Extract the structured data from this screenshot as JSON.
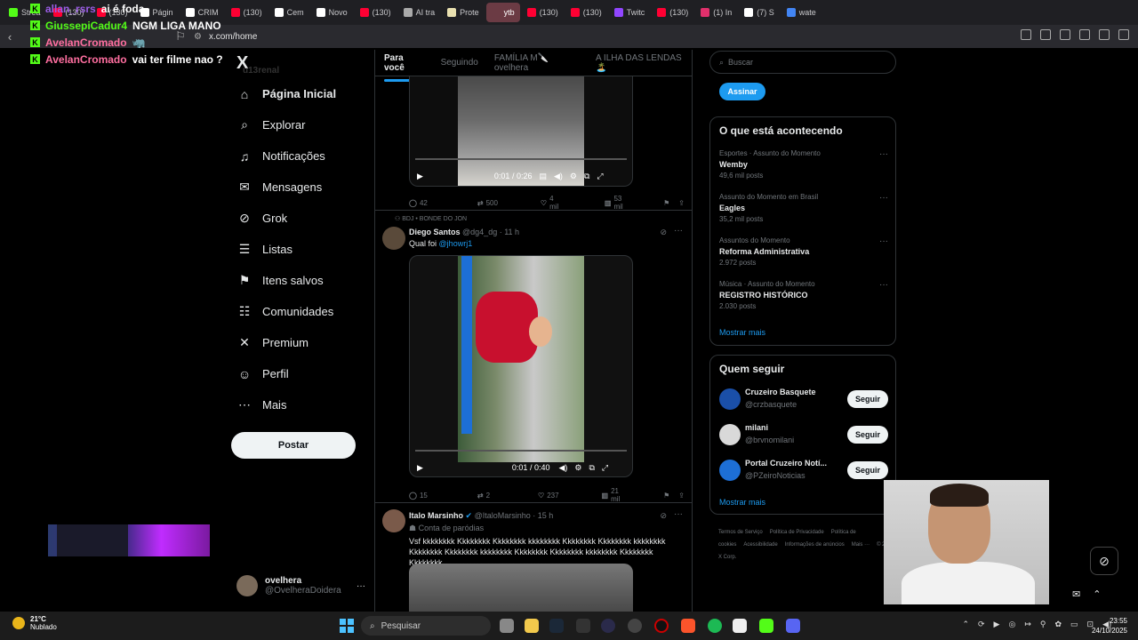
{
  "browser": {
    "tabs": [
      {
        "label": "Strea",
        "color": "#53fc18"
      },
      {
        "label": "(130)",
        "color": "#ff0033"
      },
      {
        "label": "(130)",
        "color": "#ff0033"
      },
      {
        "label": "Págin",
        "color": "#ffffff"
      },
      {
        "label": "CRIM",
        "color": "#ffffff"
      },
      {
        "label": "(130)",
        "color": "#ff0033"
      },
      {
        "label": "Cem",
        "color": "#ffffff"
      },
      {
        "label": "Novo",
        "color": "#ffffff"
      },
      {
        "label": "(130)",
        "color": "#ff0033"
      },
      {
        "label": "AI tra",
        "color": "#aaaaaa"
      },
      {
        "label": "Prote",
        "color": "#e9e0b0"
      },
      {
        "label": "ytb",
        "color": "#6b3b44"
      },
      {
        "label": "(130)",
        "color": "#ff0033"
      },
      {
        "label": "(130)",
        "color": "#ff0033"
      },
      {
        "label": "Twitc",
        "color": "#9146ff"
      },
      {
        "label": "(130)",
        "color": "#ff0033"
      },
      {
        "label": "(1) In",
        "color": "#e1306c"
      },
      {
        "label": "(7) S",
        "color": "#ffffff"
      },
      {
        "label": "wate",
        "color": "#4285f4"
      }
    ],
    "active_tab_index": 11,
    "url": "x.com/home"
  },
  "chat": [
    {
      "user": "allan_rsrs",
      "message": "ai é foda",
      "user_color": "#9b5de5"
    },
    {
      "user": "GiussepiCadur4",
      "message": "NGM LIGA MANO",
      "user_color": "#53fc18"
    },
    {
      "user": "AvelanCromado",
      "message": "🦏",
      "user_color": "#ff6fa0"
    },
    {
      "user": "AvelanCromado",
      "message": "vai ter filme nao ?",
      "user_color": "#ff6fa0"
    }
  ],
  "nav": {
    "logo": "X",
    "ghost_text": "u13renal",
    "items": [
      {
        "label": "Página Inicial",
        "icon": "home-icon",
        "glyph": "⌂"
      },
      {
        "label": "Explorar",
        "icon": "search-icon",
        "glyph": "⌕"
      },
      {
        "label": "Notificações",
        "icon": "bell-icon",
        "glyph": "♫"
      },
      {
        "label": "Mensagens",
        "icon": "mail-icon",
        "glyph": "✉"
      },
      {
        "label": "Grok",
        "icon": "grok-icon",
        "glyph": "⊘"
      },
      {
        "label": "Listas",
        "icon": "list-icon",
        "glyph": "☰"
      },
      {
        "label": "Itens salvos",
        "icon": "bookmark-icon",
        "glyph": "⚑"
      },
      {
        "label": "Comunidades",
        "icon": "communities-icon",
        "glyph": "☷"
      },
      {
        "label": "Premium",
        "icon": "premium-x-icon",
        "glyph": "✕"
      },
      {
        "label": "Perfil",
        "icon": "profile-icon",
        "glyph": "☺"
      },
      {
        "label": "Mais",
        "icon": "more-icon",
        "glyph": "⋯"
      }
    ],
    "post_label": "Postar",
    "account": {
      "name": "ovelhera",
      "handle": "@OvelheraDoidera"
    }
  },
  "feed": {
    "tabs": [
      "Para você",
      "Seguindo",
      "FAMÍLIA M🔪ovelhera",
      "A ILHA DAS LENDAS 🏝️"
    ],
    "video1": {
      "time": "0:01 / 0:26"
    },
    "stats1": {
      "replies": "42",
      "reposts": "500",
      "likes": "4 mil",
      "views": "53 mil"
    },
    "tweet2": {
      "context": "BDJ • BONDE DO JON",
      "name": "Diego Santos",
      "handle": "@dg4_dg",
      "time": "· 11 h",
      "text": "Qual foi",
      "mention": "@jhowrj1",
      "video_time": "0:01 / 0:40"
    },
    "stats2": {
      "replies": "15",
      "reposts": "2",
      "likes": "237",
      "views": "21 mil"
    },
    "tweet3": {
      "name": "Italo Marsinho",
      "handle": "@ItaloMarsinho",
      "time": "· 15 h",
      "label": "Conta de paródias",
      "text": "Vsf kkkkkkkk Kkkkkkkk Kkkkkkkk kkkkkkkk Kkkkkkkk Kkkkkkkk kkkkkkkk Kkkkkkkk Kkkkkkkk kkkkkkkk Kkkkkkkk Kkkkkkkk kkkkkkkk Kkkkkkkk Kkkkkkkk"
    }
  },
  "sidebar": {
    "search_placeholder": "Buscar",
    "subscribe_label": "Assinar",
    "trends_title": "O que está acontecendo",
    "trends": [
      {
        "category": "Esportes · Assunto do Momento",
        "name": "Wemby",
        "count": "49,6 mil posts"
      },
      {
        "category": "Assunto do Momento em Brasil",
        "name": "Eagles",
        "count": "35,2 mil posts"
      },
      {
        "category": "Assuntos do Momento",
        "name": "Reforma Administrativa",
        "count": "2.972 posts"
      },
      {
        "category": "Música · Assunto do Momento",
        "name": "REGISTRO HISTÓRICO",
        "count": "2.030 posts"
      }
    ],
    "show_more": "Mostrar mais",
    "follow_title": "Quem seguir",
    "follows": [
      {
        "name": "Cruzeiro Basquete",
        "handle": "@crzbasquete",
        "color": "#1a4fa8"
      },
      {
        "name": "milani",
        "handle": "@brvnomilani",
        "color": "#d9d9d9"
      },
      {
        "name": "Portal Cruzeiro Notí...",
        "handle": "@PZeiroNoticias",
        "color": "#1d6fd6"
      }
    ],
    "follow_label": "Seguir",
    "footer": [
      "Termos de Serviço",
      "Política de Privacidade",
      "Política de cookies",
      "Acessibilidade",
      "Informações de anúncios",
      "Mais ···",
      "© 2025 X Corp."
    ]
  },
  "taskbar": {
    "temperature": "21°C",
    "weather": "Nublado",
    "search": "Pesquisar",
    "time": "23:55",
    "date": "24/10/2025"
  }
}
